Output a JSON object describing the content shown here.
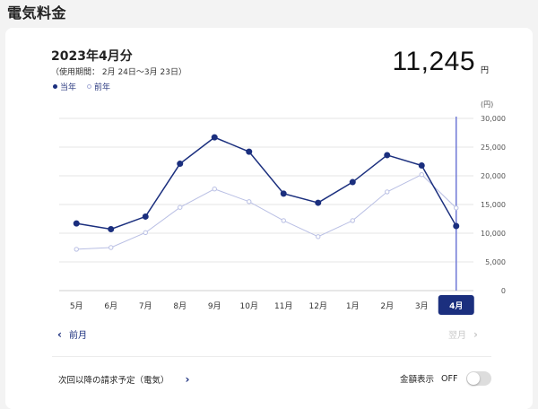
{
  "page_title": "電気料金",
  "period": {
    "title": "2023年4月分",
    "range": "（使用期間： 2月 24日～3月 23日）"
  },
  "legend": {
    "current": "当年",
    "previous": "前年"
  },
  "amount": {
    "value": "11,245",
    "unit": "円"
  },
  "colors": {
    "current_series": "#1b2f7e",
    "previous_series": "#b9bfe4",
    "selected_line": "#6f79d6",
    "selected_tab": "#1b2f7e"
  },
  "chart_data": {
    "type": "line",
    "categories": [
      "5月",
      "6月",
      "7月",
      "8月",
      "9月",
      "10月",
      "11月",
      "12月",
      "1月",
      "2月",
      "3月",
      "4月"
    ],
    "selected_category": "4月",
    "series": [
      {
        "name": "当年",
        "values": [
          11700,
          10700,
          12900,
          22100,
          26700,
          24200,
          16900,
          15300,
          18900,
          23600,
          21800,
          11245
        ]
      },
      {
        "name": "前年",
        "values": [
          7200,
          7500,
          10100,
          14500,
          17700,
          15500,
          12200,
          9400,
          12200,
          17200,
          20200,
          14400
        ]
      }
    ],
    "yunit": "(円)",
    "yticks": [
      "30,000",
      "25,000",
      "20,000",
      "15,000",
      "10,000",
      "5,000",
      "0"
    ],
    "ylim": [
      0,
      30000
    ],
    "grid": true
  },
  "nav": {
    "prev_label": "前月",
    "next_label": "翌月"
  },
  "footer": {
    "next_bill_label": "次回以降の請求予定（電気）",
    "amount_display_label": "金額表示",
    "toggle_state": "OFF"
  }
}
